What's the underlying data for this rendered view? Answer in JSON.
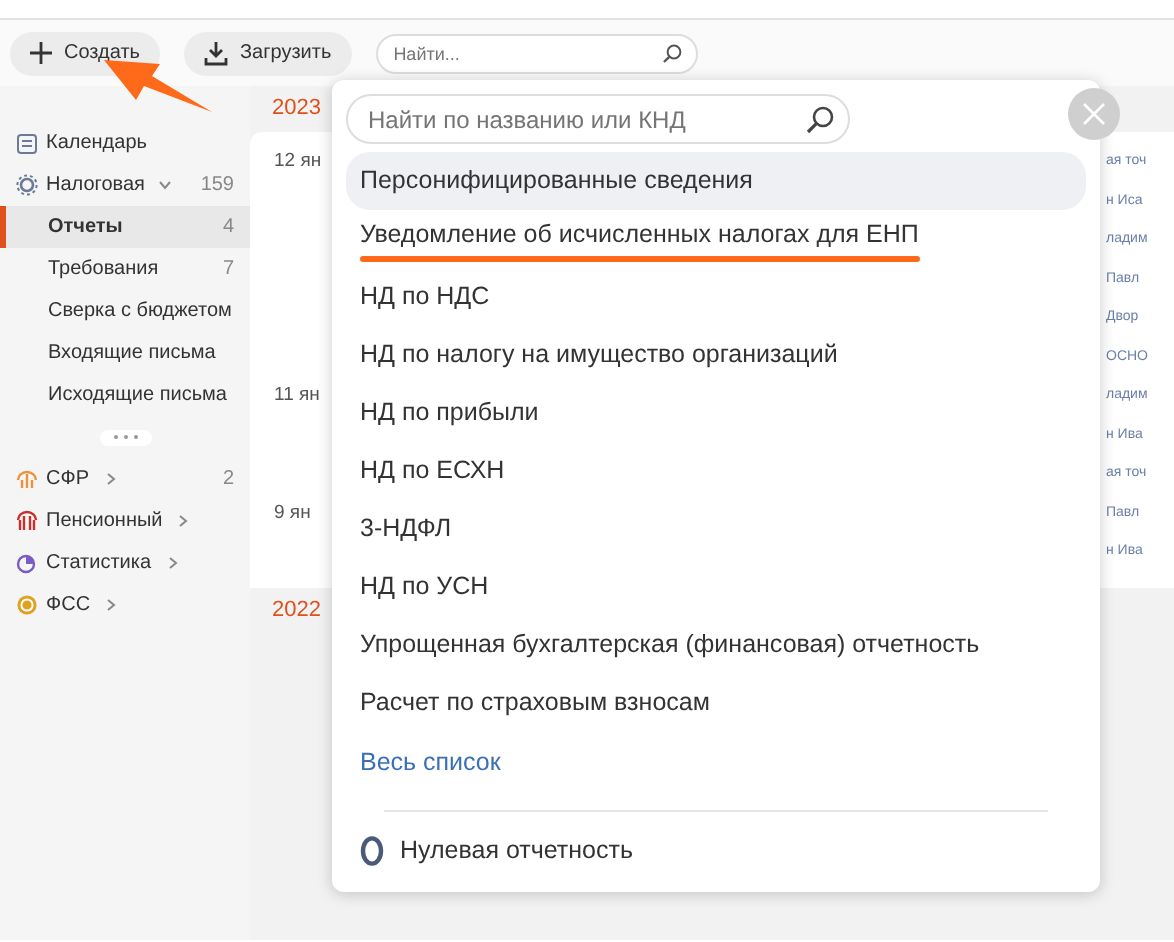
{
  "toolbar": {
    "create_button": "Создать",
    "upload_button": "Загрузить",
    "search": {
      "placeholder": "Найти..."
    }
  },
  "callout_arrow": true,
  "sidebar": {
    "items": [
      {
        "kind": "calendar",
        "label": "Календарь",
        "color": "#6b7a99"
      },
      {
        "kind": "tax",
        "label": "Налоговая",
        "color": "#6b7a99",
        "count": "159",
        "expanded": true,
        "children": [
          {
            "label": "Отчеты",
            "count": "4",
            "selected": true
          },
          {
            "label": "Требования",
            "count": "7",
            "selected": false
          },
          {
            "label": "Сверка с бюджетом",
            "selected": false
          },
          {
            "label": "Входящие письма",
            "selected": false
          },
          {
            "label": "Исходящие письма",
            "selected": false
          }
        ]
      },
      {
        "kind": "more"
      },
      {
        "kind": "sfr",
        "label": "СФР",
        "color": "#f0903c",
        "count": "2",
        "expanded": false
      },
      {
        "kind": "pension",
        "label": "Пенсионный",
        "color": "#c8302c",
        "expanded": false
      },
      {
        "kind": "stats",
        "label": "Статистика",
        "color": "#7a5cc4",
        "expanded": false
      },
      {
        "kind": "fss",
        "label": "ФСС",
        "color": "#e0a020",
        "expanded": false
      }
    ]
  },
  "main": {
    "groups": [
      {
        "year": "2023",
        "rows": [
          {
            "date": "12 ян",
            "peek": "ая точ"
          },
          {
            "peek": "н Иса"
          },
          {
            "peek": "ладим"
          },
          {
            "peek": "Павл"
          },
          {
            "peek": "Двор"
          },
          {
            "peek": "ОСНО"
          },
          {
            "date": "11 ян",
            "peek": "ладим"
          },
          {
            "peek": "н Ива"
          },
          {
            "peek": "ая точ"
          },
          {
            "date": "9 ян",
            "peek": "Павл"
          },
          {
            "peek": "н Ива"
          }
        ]
      },
      {
        "year": "2022"
      }
    ]
  },
  "popup": {
    "search": {
      "placeholder": "Найти по названию или КНД"
    },
    "items": [
      {
        "label": "Персонифицированные сведения",
        "selected": true,
        "underlined": false
      },
      {
        "label": "Уведомление об исчисленных налогах для ЕНП",
        "selected": false,
        "underlined": true
      },
      {
        "label": "НД по НДС",
        "selected": false,
        "underlined": false
      },
      {
        "label": "НД по налогу на имущество организаций",
        "selected": false,
        "underlined": false
      },
      {
        "label": "НД по прибыли",
        "selected": false,
        "underlined": false
      },
      {
        "label": "НД по ЕСХН",
        "selected": false,
        "underlined": false
      },
      {
        "label": "3-НДФЛ",
        "selected": false,
        "underlined": false
      },
      {
        "label": "НД по УСН",
        "selected": false,
        "underlined": false
      },
      {
        "label": "Упрощенная бухгалтерская (финансовая) отчетность",
        "selected": false,
        "underlined": false
      },
      {
        "label": "Расчет по страховым взносам",
        "selected": false,
        "underlined": false
      }
    ],
    "all_link": "Весь список",
    "footer": "Нулевая отчетность"
  }
}
